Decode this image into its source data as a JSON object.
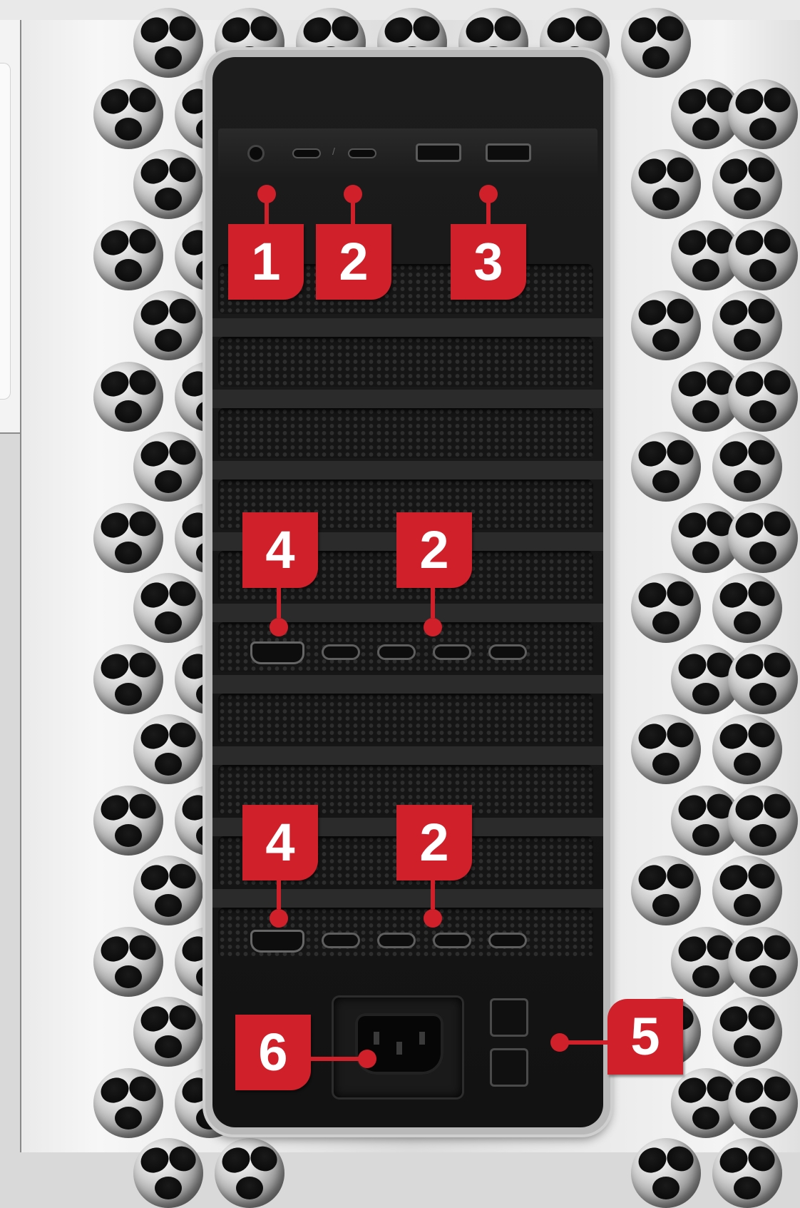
{
  "image": {
    "subject": "computer-rear-panel",
    "accent_color": "#d0202a",
    "panel_color": "#141414",
    "chassis_color": "#e2e2e2"
  },
  "callouts": {
    "c1": "1",
    "c2_top": "2",
    "c3": "3",
    "c4_upper": "4",
    "c2_upper": "2",
    "c4_lower": "4",
    "c2_lower": "2",
    "c5": "5",
    "c6": "6"
  },
  "top_ports": {
    "separator": "/"
  }
}
